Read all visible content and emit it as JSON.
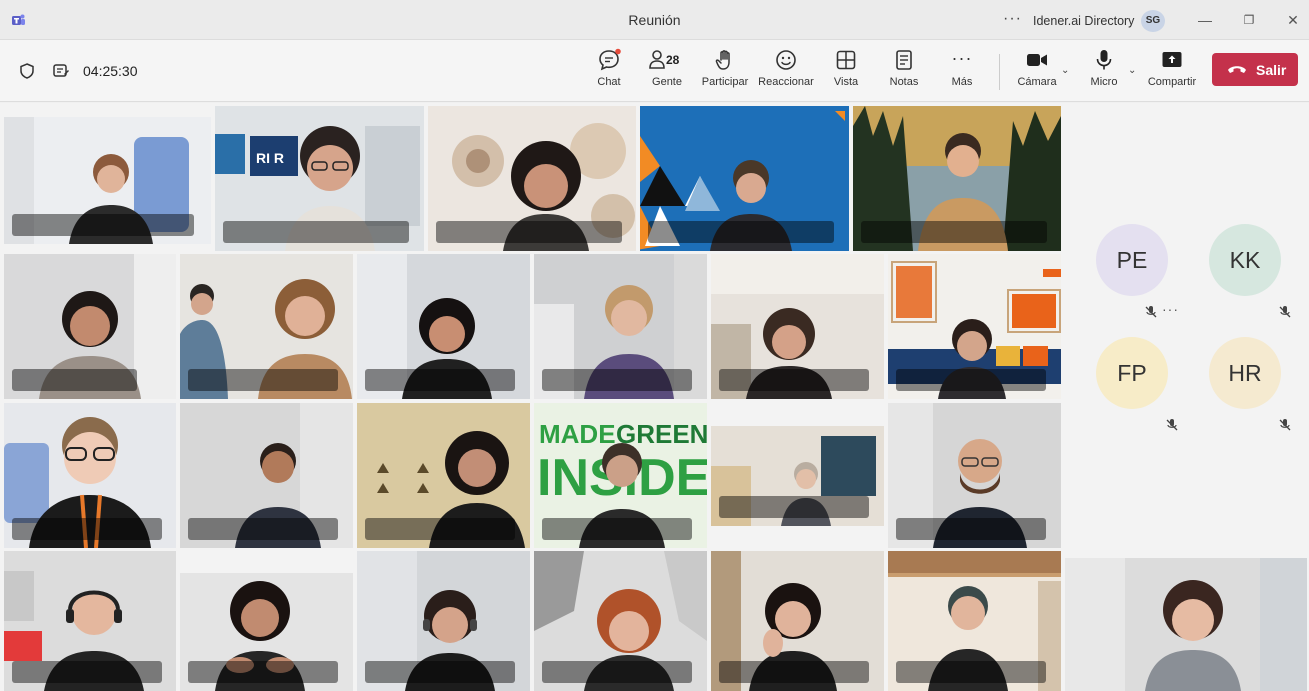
{
  "window": {
    "title": "Reunión",
    "more_dots": "···",
    "directory": "Idener.ai Directory",
    "user_initials": "SG",
    "minimize": "—",
    "restore": "❐",
    "close": "✕"
  },
  "toolbar": {
    "timer": "04:25:30",
    "buttons": [
      {
        "label": "Chat",
        "icon": "chat-icon"
      },
      {
        "label": "Gente",
        "icon": "people-icon",
        "count": "28"
      },
      {
        "label": "Participar",
        "icon": "raise-hand-icon"
      },
      {
        "label": "Reaccionar",
        "icon": "emoji-icon"
      },
      {
        "label": "Vista",
        "icon": "view-grid-icon"
      },
      {
        "label": "Notas",
        "icon": "notes-icon"
      },
      {
        "label": "Más",
        "icon": "more-icon"
      },
      {
        "label": "Cámara",
        "icon": "camera-icon"
      },
      {
        "label": "Micro",
        "icon": "microphone-icon"
      },
      {
        "label": "Compartir",
        "icon": "share-screen-icon"
      }
    ],
    "more_glyph": "···",
    "chevron": "⌄",
    "leave_label": "Salir"
  },
  "avatars": [
    {
      "initials": "PE",
      "color": "#e4e0f0"
    },
    {
      "initials": "KK",
      "color": "#d6e7df"
    },
    {
      "initials": "FP",
      "color": "#f7ecc8"
    },
    {
      "initials": "HR",
      "color": "#f5ead0"
    }
  ],
  "avatar_more": "···",
  "tiles_nametag_placeholder": "                         ",
  "colors": {
    "leave": "#c4314b",
    "accent": "#5b5fc7"
  },
  "made_green_text": [
    "MADE",
    "GREEN",
    "INSIDE"
  ]
}
